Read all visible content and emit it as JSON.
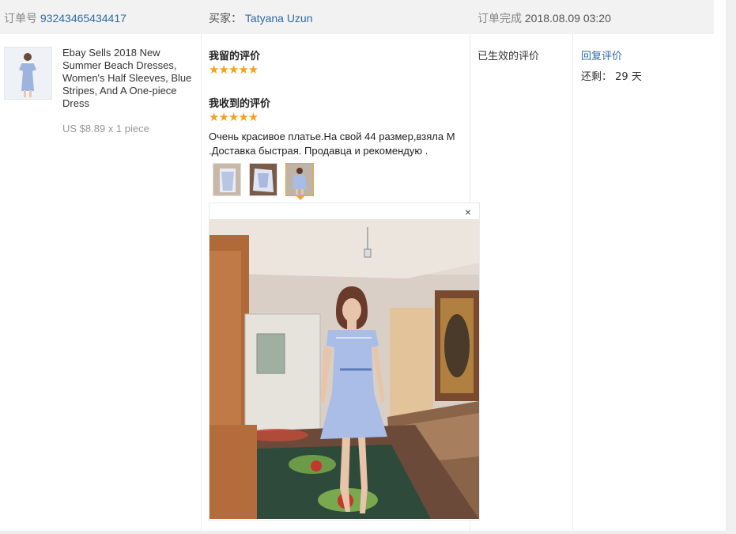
{
  "order": {
    "number_label": "订单号",
    "number": "93243465434417",
    "buyer_label": "买家：",
    "buyer_name": "Tatyana Uzun",
    "completed_label": "订单完成",
    "completed_time": "2018.08.09 03:20"
  },
  "product": {
    "title": "Ebay Sells 2018 New Summer Beach Dresses, Women's Half Sleeves, Blue Stripes, And A One-piece Dress",
    "price": "US $8.89 x 1 piece"
  },
  "feedback": {
    "given_label": "我留的评价",
    "given_rating": 5,
    "received_label": "我收到的评价",
    "received_rating": 5,
    "comment": "Очень красивое платье.На свой 44 размер,взяла М .Доставка быстрая. Продавца и рекомендую .",
    "photos": [
      {
        "icon": "dress-photo-thumbnail",
        "selected": false
      },
      {
        "icon": "dress-photo-thumbnail",
        "selected": false
      },
      {
        "icon": "dress-photo-thumbnail",
        "selected": true
      }
    ],
    "viewer_close_symbol": "×"
  },
  "status": {
    "text": "已生效的评价"
  },
  "actions": {
    "reply_label": "回复评价",
    "remaining_label": "还剩：",
    "remaining_value": "29 天"
  },
  "colors": {
    "link": "#2e6aa6",
    "star": "#f7a01b",
    "active_border": "#f0a13a"
  }
}
